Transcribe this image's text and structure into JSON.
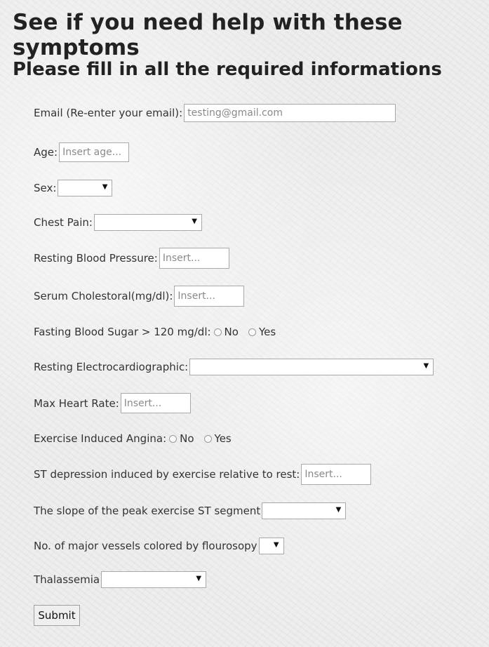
{
  "title": "See if you need help with these symptoms",
  "subtitle": "Please fill in all the required informations",
  "email": {
    "label": "Email (Re-enter your email):",
    "placeholder": "testing@gmail.com"
  },
  "age": {
    "label": "Age:",
    "placeholder": "Insert age..."
  },
  "sex": {
    "label": "Sex:",
    "value": ""
  },
  "chest_pain": {
    "label": "Chest Pain:",
    "value": ""
  },
  "resting_bp": {
    "label": "Resting Blood Pressure:",
    "placeholder": "Insert..."
  },
  "cholesterol": {
    "label": "Serum Cholestoral(mg/dl):",
    "placeholder": "Insert..."
  },
  "fbs": {
    "label": "Fasting Blood Sugar > 120 mg/dl:",
    "no": "No",
    "yes": "Yes"
  },
  "ecg": {
    "label": "Resting Electrocardiographic:",
    "value": ""
  },
  "max_hr": {
    "label": "Max Heart Rate:",
    "placeholder": "Insert..."
  },
  "angina": {
    "label": "Exercise Induced Angina:",
    "no": "No",
    "yes": "Yes"
  },
  "st_depression": {
    "label": "ST depression induced by exercise relative to rest:",
    "placeholder": "Insert..."
  },
  "slope": {
    "label": "The slope of the peak exercise ST segment",
    "value": ""
  },
  "vessels": {
    "label": "No. of major vessels colored by flourosopy",
    "value": ""
  },
  "thalassemia": {
    "label": "Thalassemia",
    "value": ""
  },
  "submit_label": "Submit",
  "icons": {
    "dropdown": "chevron-down-icon",
    "radio": "radio-icon"
  }
}
